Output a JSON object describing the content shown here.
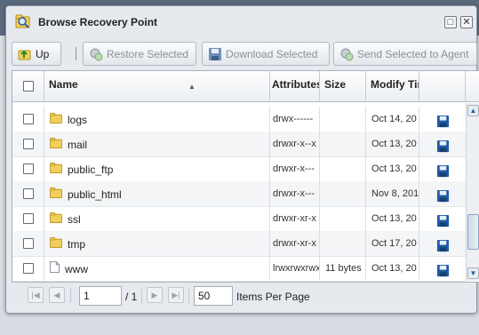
{
  "dialog": {
    "title": "Browse Recovery Point",
    "maximize_glyph": "□",
    "close_glyph": "✕"
  },
  "toolbar": {
    "up_label": "Up",
    "restore_label": "Restore Selected",
    "download_label": "Download Selected",
    "send_label": "Send Selected to Agent"
  },
  "grid": {
    "columns": {
      "name": "Name",
      "attributes": "Attributes",
      "size": "Size",
      "modify_time": "Modify Tim"
    },
    "sort_glyph": "▲",
    "rows": [
      {
        "name": "logs",
        "type": "folder",
        "attributes": "drwx------",
        "size": "",
        "modified": "Oct 14, 20"
      },
      {
        "name": "mail",
        "type": "folder",
        "attributes": "drwxr-x--x",
        "size": "",
        "modified": "Oct 13, 20"
      },
      {
        "name": "public_ftp",
        "type": "folder",
        "attributes": "drwxr-x---",
        "size": "",
        "modified": "Oct 13, 20"
      },
      {
        "name": "public_html",
        "type": "folder",
        "attributes": "drwxr-x---",
        "size": "",
        "modified": "Nov 8, 201"
      },
      {
        "name": "ssl",
        "type": "folder",
        "attributes": "drwxr-xr-x",
        "size": "",
        "modified": "Oct 13, 20"
      },
      {
        "name": "tmp",
        "type": "folder",
        "attributes": "drwxr-xr-x",
        "size": "",
        "modified": "Oct 17, 20"
      },
      {
        "name": "www",
        "type": "file",
        "attributes": "lrwxrwxrwx",
        "size": "11 bytes",
        "modified": "Oct 13, 20"
      }
    ],
    "scroll_position": 0.85
  },
  "pager": {
    "page": "1",
    "page_total": "/ 1",
    "per_page": "50",
    "per_page_label": "Items Per Page"
  },
  "colors": {
    "accent": "#1c5fa6",
    "folder": "#e9c24a",
    "save_icon": "#1f5aa5"
  },
  "icons": {
    "title": "magnifier-folder-icon",
    "up": "folder-up-icon",
    "restore": "restore-icon",
    "download": "save-icon",
    "send": "send-to-agent-icon",
    "row_folder": "folder-icon",
    "row_file": "file-icon",
    "row_action": "save-icon"
  }
}
